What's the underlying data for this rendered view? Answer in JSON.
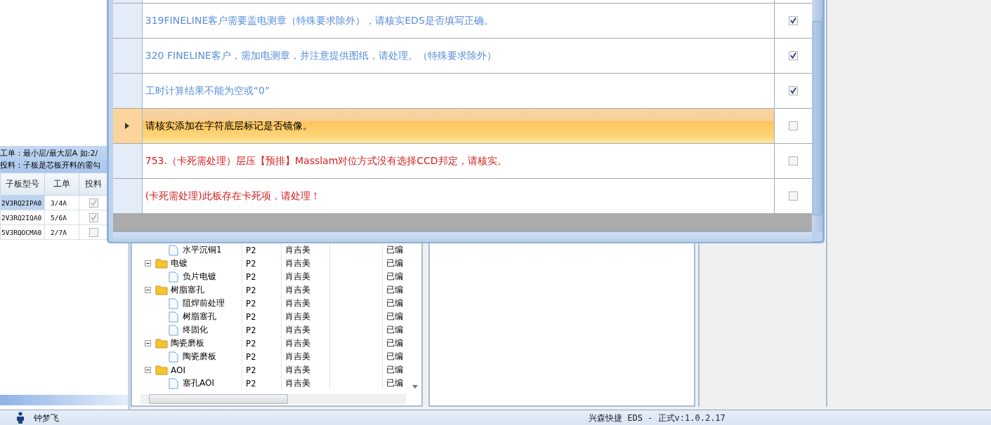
{
  "left_panel": {
    "hint_lines": [
      "工单：最小层/最大层A 如:2/",
      "投料：子板是芯板开料的需勾"
    ],
    "table": {
      "columns": [
        "子板型号",
        "工单",
        "投料"
      ],
      "rows": [
        {
          "cells": [
            "2V3RQ2IPA0",
            "3/4A"
          ],
          "checked": true,
          "selected": true
        },
        {
          "cells": [
            "2V3RQ2IQA0",
            "5/6A"
          ],
          "checked": true,
          "selected": false
        },
        {
          "cells": [
            "5V3RQOCMA0",
            "2/7A"
          ],
          "checked": false,
          "selected": false
        }
      ]
    }
  },
  "tree": {
    "nodes": [
      {
        "children": [
          {
            "name": "水平沉铜1",
            "layer": "P2",
            "owner": "肖吉美",
            "status": "已编"
          }
        ]
      },
      {
        "name": "电镀",
        "layer": "P2",
        "owner": "肖吉美",
        "status": "已编",
        "expanded": true,
        "children": [
          {
            "name": "负片电镀",
            "layer": "P2",
            "owner": "肖吉美",
            "status": "已编"
          }
        ]
      },
      {
        "name": "树脂塞孔",
        "layer": "P2",
        "owner": "肖吉美",
        "status": "已编",
        "expanded": true,
        "children": [
          {
            "name": "阻焊前处理",
            "layer": "P2",
            "owner": "肖吉美",
            "status": "已编"
          },
          {
            "name": "树脂塞孔",
            "layer": "P2",
            "owner": "肖吉美",
            "status": "已编"
          },
          {
            "name": "终固化",
            "layer": "P2",
            "owner": "肖吉美",
            "status": "已编"
          }
        ]
      },
      {
        "name": "陶瓷磨板",
        "layer": "P2",
        "owner": "肖吉美",
        "status": "已编",
        "expanded": true,
        "children": [
          {
            "name": "陶瓷磨板",
            "layer": "P2",
            "owner": "肖吉美",
            "status": "已编"
          }
        ]
      },
      {
        "name": "AOI",
        "layer": "P2",
        "owner": "肖吉美",
        "status": "已编",
        "expanded": true,
        "children": [
          {
            "name": "塞孔AOI",
            "layer": "P2",
            "owner": "肖吉美",
            "status": "已编"
          }
        ]
      }
    ]
  },
  "dialog": {
    "rows": [
      {
        "text": "319FINELINE客户需要盖电测章（特殊要求除外），请核实EDS是否填写正确。",
        "color": "#5b8edb",
        "checked": true,
        "selected": false
      },
      {
        "text": "320 FINELINE客户，需加电测章，并注意提供图纸，请处理。（特殊要求除外）",
        "color": "#5b8edb",
        "checked": true,
        "selected": false
      },
      {
        "text": "工时计算结果不能为空或“0”",
        "color": "#5b8edb",
        "checked": true,
        "selected": false
      },
      {
        "text": "请核实添加在字符底层标记是否镜像。",
        "color": "#000000",
        "checked": false,
        "selected": true
      },
      {
        "text": "753.（卡死需处理）层压【预排】Masslam对位方式没有选择CCD邦定，请核实。",
        "color": "#d42020",
        "checked": false,
        "selected": false
      },
      {
        "text": "(卡死需处理)此板存在卡死项，请处理！",
        "color": "#d42020",
        "checked": false,
        "selected": false
      }
    ]
  },
  "status_bar": {
    "user": "钟梦飞",
    "app": "兴森快捷 EDS - 正式v:1.0.2.17"
  }
}
